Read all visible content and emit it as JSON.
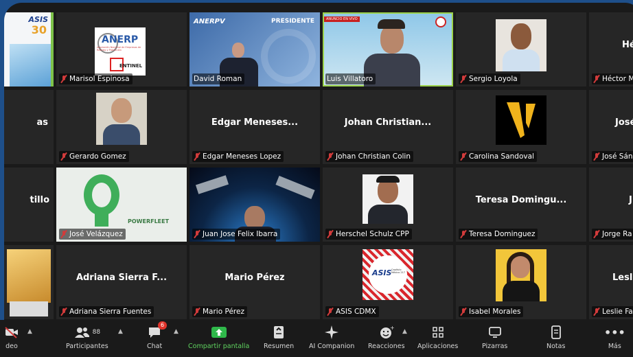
{
  "participants": [
    {
      "name": "",
      "big": "",
      "muted": false
    },
    {
      "name": "Marisol Espinosa",
      "big": "",
      "muted": true
    },
    {
      "name": "David Roman",
      "big": "",
      "muted": false,
      "overlay": "PRESIDENTE"
    },
    {
      "name": "Luis Villatoro",
      "big": "",
      "muted": false
    },
    {
      "name": "Sergio  Loyola",
      "big": "",
      "muted": true
    },
    {
      "name": "Héctor M",
      "big": "Hé",
      "muted": true
    },
    {
      "name": "",
      "big": "as",
      "muted": false
    },
    {
      "name": "Gerardo Gomez",
      "big": "",
      "muted": true
    },
    {
      "name": "Edgar Meneses Lopez",
      "big": "Edgar  Meneses...",
      "muted": true
    },
    {
      "name": "Johan Christian Colin",
      "big": "Johan  Christian...",
      "muted": true
    },
    {
      "name": "Carolina Sandoval",
      "big": "",
      "muted": true
    },
    {
      "name": "José Sán",
      "big": "José",
      "muted": true
    },
    {
      "name": "",
      "big": "tillo",
      "muted": false
    },
    {
      "name": "José Velázquez",
      "big": "",
      "muted": true
    },
    {
      "name": "Juan Jose Felix Ibarra",
      "big": "",
      "muted": true
    },
    {
      "name": "Herschel Schulz CPP",
      "big": "",
      "muted": true
    },
    {
      "name": "Teresa Dominguez",
      "big": "Teresa  Domingu...",
      "muted": true
    },
    {
      "name": "Jorge Ra",
      "big": "J",
      "muted": true
    },
    {
      "name": "",
      "big": "",
      "muted": false
    },
    {
      "name": "Adriana Sierra Fuentes",
      "big": "Adriana  Sierra  F...",
      "muted": true
    },
    {
      "name": "Mario Pérez",
      "big": "Mario Pérez",
      "muted": true
    },
    {
      "name": "ASIS CDMX",
      "big": "",
      "muted": true
    },
    {
      "name": "Isabel Morales",
      "big": "",
      "muted": true
    },
    {
      "name": "Leslie Fa",
      "big": "Leslie",
      "muted": true
    }
  ],
  "logos": {
    "anerp": "ANERP",
    "anerp_sub": "Asociación Nacional de Empresas de Rastreo y Protección",
    "sentinel": "ENTINEL",
    "anerpv": "ANERPV",
    "asis": "ASIS",
    "asis_30": "30",
    "asis_cdmx": "ASIS",
    "asis_cdmx_sub": "Capítulo México 217",
    "powerfleet": "POWERFLEET",
    "live": "ANUNCIO EN VIVO"
  },
  "toolbar": {
    "video": "deo",
    "participants": "Participantes",
    "participants_count": "88",
    "chat": "Chat",
    "chat_badge": "6",
    "share": "Compartir pantalla",
    "summary": "Resumen",
    "ai": "AI Companion",
    "reactions": "Reacciones",
    "apps": "Aplicaciones",
    "whiteboards": "Pizarras",
    "notes": "Notas",
    "more": "Más"
  },
  "colors": {
    "accent_green": "#5fd35f",
    "mute_red": "#d23b3b",
    "tile_bg": "#262626",
    "border_blue": "#1e4f8a"
  }
}
